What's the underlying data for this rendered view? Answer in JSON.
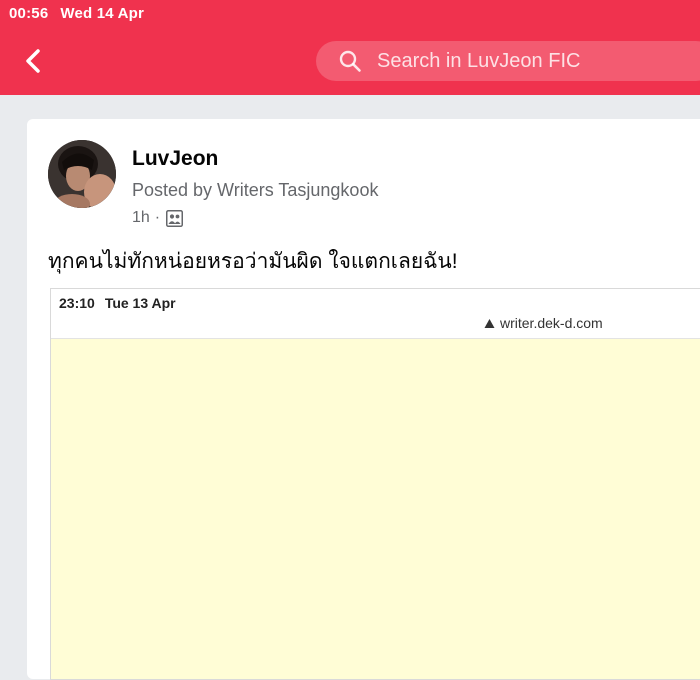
{
  "status_bar": {
    "time": "00:56",
    "date": "Wed 14 Apr"
  },
  "header": {
    "back_icon": "chevron-left-icon",
    "search": {
      "placeholder": "Search in LuvJeon FIC",
      "icon": "search-icon"
    }
  },
  "post": {
    "author": "LuvJeon",
    "posted_by": "Posted by Writers Tasjungkook",
    "time_ago": "1h",
    "separator": "·",
    "audience_icon": "group-icon",
    "text": "ทุกคนไม่ทักหน่อยหรอว่ามันผิด ใจแตกเลยฉัน!",
    "attachment": {
      "time": "23:10",
      "date": "Tue 13 Apr",
      "url": "writer.dek-d.com",
      "url_icon": "lock-icon"
    }
  },
  "colors": {
    "brand": "#f0324e",
    "attachment_bg": "#fffdd6"
  }
}
